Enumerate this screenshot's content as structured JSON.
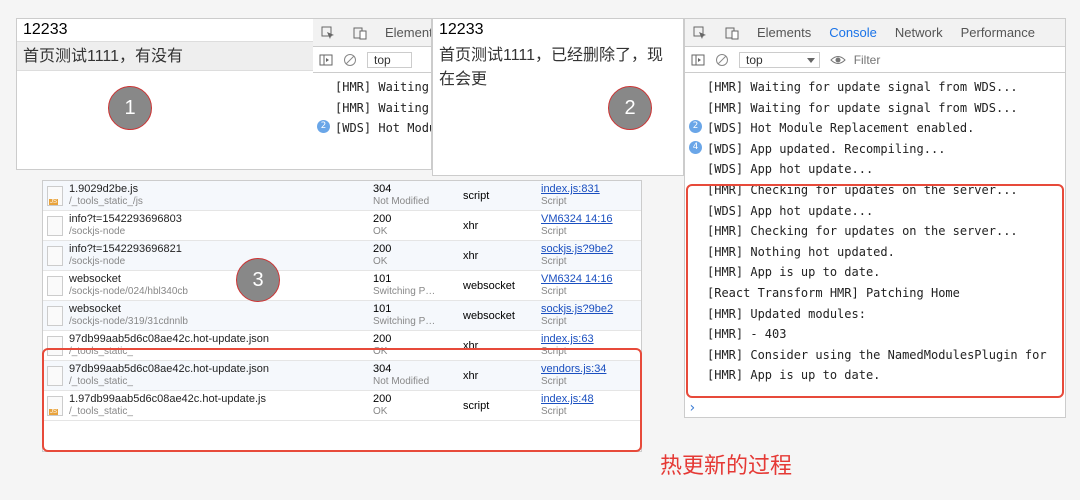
{
  "panel1": {
    "header": "12233",
    "sub": "首页测试1111，有没有",
    "tabs": {
      "elements": "Element"
    },
    "context": "top",
    "logs": [
      {
        "text": "[HMR] Waiting"
      },
      {
        "text": "[HMR] Waiting"
      },
      {
        "text": "[WDS] Hot Modu",
        "badge": "2"
      }
    ]
  },
  "panel2": {
    "header": "12233",
    "sub": "首页测试1111，已经删除了，现在会更"
  },
  "annotations": {
    "a1": "1",
    "a2": "2",
    "a3": "3"
  },
  "caption": "热更新的过程",
  "network": {
    "rows": [
      {
        "name": "1.9029d2be.js",
        "path": "/_tools_static_/js",
        "status": "304",
        "statusText": "Not Modified",
        "type": "script",
        "init": "index.js:831",
        "initSub": "Script",
        "js": true
      },
      {
        "name": "info?t=1542293696803",
        "path": "/sockjs-node",
        "status": "200",
        "statusText": "OK",
        "type": "xhr",
        "init": "VM6324 14:16",
        "initSub": "Script"
      },
      {
        "name": "info?t=1542293696821",
        "path": "/sockjs-node",
        "status": "200",
        "statusText": "OK",
        "type": "xhr",
        "init": "sockjs.js?9be2",
        "initSub": "Script"
      },
      {
        "name": "websocket",
        "path": "/sockjs-node/024/hbl340cb",
        "status": "101",
        "statusText": "Switching P…",
        "type": "websocket",
        "init": "VM6324 14:16",
        "initSub": "Script"
      },
      {
        "name": "websocket",
        "path": "/sockjs-node/319/31cdnnlb",
        "status": "101",
        "statusText": "Switching P…",
        "type": "websocket",
        "init": "sockjs.js?9be2",
        "initSub": "Script"
      },
      {
        "name": "97db99aab5d6c08ae42c.hot-update.json",
        "path": "/_tools_static_",
        "status": "200",
        "statusText": "OK",
        "type": "xhr",
        "init": "index.js:63",
        "initSub": "Script"
      },
      {
        "name": "97db99aab5d6c08ae42c.hot-update.json",
        "path": "/_tools_static_",
        "status": "304",
        "statusText": "Not Modified",
        "type": "xhr",
        "init": "vendors.js:34",
        "initSub": "Script"
      },
      {
        "name": "1.97db99aab5d6c08ae42c.hot-update.js",
        "path": "/_tools_static_",
        "status": "200",
        "statusText": "OK",
        "type": "script",
        "init": "index.js:48",
        "initSub": "Script",
        "js": true
      }
    ]
  },
  "devtools": {
    "tabs": {
      "elements": "Elements",
      "console": "Console",
      "network": "Network",
      "performance": "Performance"
    },
    "context": "top",
    "filter_placeholder": "Filter",
    "logs": [
      {
        "text": "[HMR] Waiting for update signal from WDS..."
      },
      {
        "text": "[HMR] Waiting for update signal from WDS..."
      },
      {
        "text": "[WDS] Hot Module Replacement enabled.",
        "badge": "2"
      },
      {
        "text": "[WDS] App updated. Recompiling...",
        "badge": "4"
      },
      {
        "text": "[WDS] App hot update..."
      },
      {
        "text": "[HMR] Checking for updates on the server..."
      },
      {
        "text": "[WDS] App hot update..."
      },
      {
        "text": "[HMR] Checking for updates on the server..."
      },
      {
        "text": "[HMR] Nothing hot updated."
      },
      {
        "text": "[HMR] App is up to date."
      },
      {
        "text": "[React Transform HMR] Patching Home"
      },
      {
        "text": "[HMR] Updated modules:"
      },
      {
        "text": "[HMR]  - 403"
      },
      {
        "text": "[HMR] Consider using the NamedModulesPlugin for"
      },
      {
        "text": "[HMR] App is up to date."
      }
    ]
  }
}
